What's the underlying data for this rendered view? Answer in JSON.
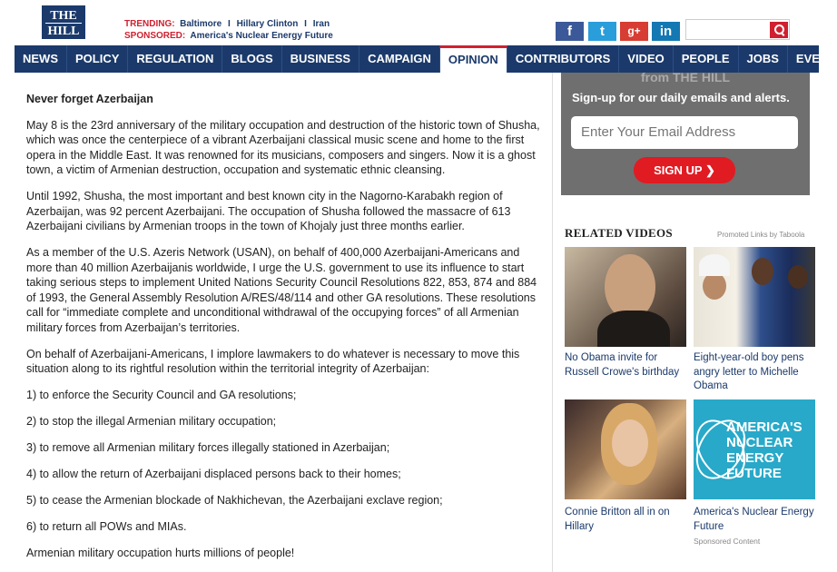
{
  "header": {
    "logo_line1": "THE",
    "logo_line2": "HILL",
    "trending_label": "TRENDING:",
    "trending_items": [
      "Baltimore",
      "Hillary Clinton",
      "Iran"
    ],
    "trending_sep": "I",
    "sponsored_label": "SPONSORED:",
    "sponsored_text": "America's Nuclear Energy Future",
    "social": {
      "facebook": "f",
      "twitter": "t",
      "googleplus": "g+",
      "linkedin": "in"
    }
  },
  "nav": {
    "items": [
      "NEWS",
      "POLICY",
      "REGULATION",
      "BLOGS",
      "BUSINESS",
      "CAMPAIGN",
      "OPINION",
      "CONTRIBUTORS",
      "VIDEO",
      "PEOPLE",
      "JOBS",
      "EVENTS"
    ],
    "active": "OPINION"
  },
  "article": {
    "title": "Never forget Azerbaijan",
    "paragraphs": [
      "May 8 is the 23rd anniversary of the military occupation and destruction of the historic town of Shusha, which was once the centerpiece of a vibrant Azerbaijani classical music scene and home to the first opera in the Middle East. It was renowned for its musicians, composers and singers. Now it is a ghost town, a victim of Armenian destruction, occupation and systematic ethnic cleansing.",
      "Until 1992, Shusha, the most important and best known city in the Nagorno-Karabakh region of Azerbaijan, was 92 percent Azerbaijani. The occupation of Shusha followed the massacre of 613 Azerbaijani civilians by Armenian troops in the town of Khojaly just three months earlier.",
      "As a member of the U.S. Azeris Network (USAN), on behalf of 400,000 Azerbaijani-Americans and more than 40 million Azerbaijanis worldwide, I urge the U.S. government to use its influence to start taking serious steps to implement United Nations Security Council Resolutions 822, 853, 874 and 884 of 1993, the General Assembly Resolution A/RES/48/114 and other GA resolutions. These resolutions call for “immediate complete and unconditional withdrawal of the occupying forces” of all Armenian military forces from Azerbaijan’s territories.",
      "On behalf of Azerbaijani-Americans, I implore lawmakers to do whatever is necessary to move this situation along to its rightful resolution within the territorial integrity of Azerbaijan:",
      "1) to enforce the Security Council and GA resolutions;",
      "2) to stop the illegal Armenian military occupation;",
      "3) to remove all Armenian military forces illegally stationed in Azerbaijan;",
      "4) to allow the return of Azerbaijani displaced persons back to their homes;",
      "5) to cease the Armenian blockade of Nakhichevan, the Azerbaijani exclave region;",
      "6) to return all POWs and MIAs.",
      "Armenian military occupation hurts millions of people!"
    ]
  },
  "signup": {
    "top_text": "from THE HILL",
    "text": "Sign-up for our daily emails and alerts.",
    "email_placeholder": "Enter Your Email Address",
    "button_label": "SIGN UP ❯"
  },
  "related": {
    "title": "RELATED VIDEOS",
    "promo": "Promoted Links by Taboola",
    "items": [
      {
        "caption": "No Obama invite for Russell Crowe's birthday"
      },
      {
        "caption": "Eight-year-old boy pens angry letter to Michelle Obama"
      },
      {
        "caption": "Connie Britton all in on Hillary"
      },
      {
        "caption": "America's Nuclear Energy Future",
        "sponsored": "Sponsored Content",
        "image_text": "AMERICA'S NUCLEAR ENERGY FUTURE"
      }
    ]
  },
  "colors": {
    "navy": "#1b3a6b",
    "red": "#d0202f",
    "grey_box": "#6f6f6f"
  }
}
